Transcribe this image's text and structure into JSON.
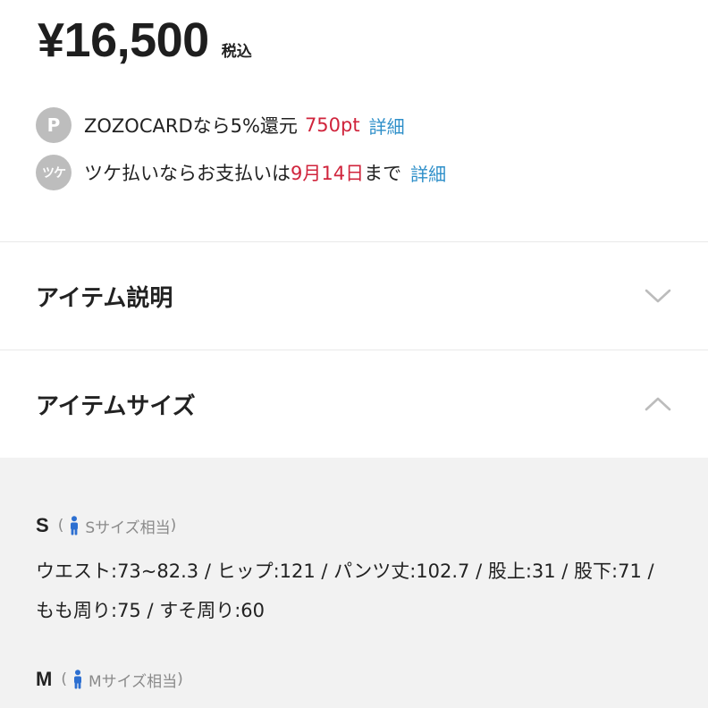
{
  "price": {
    "amount": "¥16,500",
    "tax_label": "税込"
  },
  "points": {
    "zozocard": {
      "badge": "P",
      "text": "ZOZOCARDなら5%還元",
      "points": "750pt",
      "link": "詳細"
    },
    "tsuke": {
      "badge": "ツケ",
      "text_before": "ツケ払いならお支払いは",
      "date": "9月14日",
      "text_after": "まで",
      "link": "詳細"
    }
  },
  "sections": {
    "description": {
      "title": "アイテム説明",
      "expanded": false
    },
    "size": {
      "title": "アイテムサイズ",
      "expanded": true
    }
  },
  "sizes": [
    {
      "code": "S",
      "note_open": "(",
      "note": "Sサイズ相当",
      "note_close": ")",
      "detail": "ウエスト:73~82.3 / ヒップ:121 / パンツ丈:102.7 / 股上:31 / 股下:71 / もも周り:75 / すそ周り:60"
    },
    {
      "code": "M",
      "note_open": "(",
      "note": "Mサイズ相当",
      "note_close": ")"
    }
  ],
  "colors": {
    "accent_red": "#d0243c",
    "link_blue": "#2e8fc9",
    "panel_gray": "#f2f2f2",
    "person_blue": "#2c6fd1"
  }
}
